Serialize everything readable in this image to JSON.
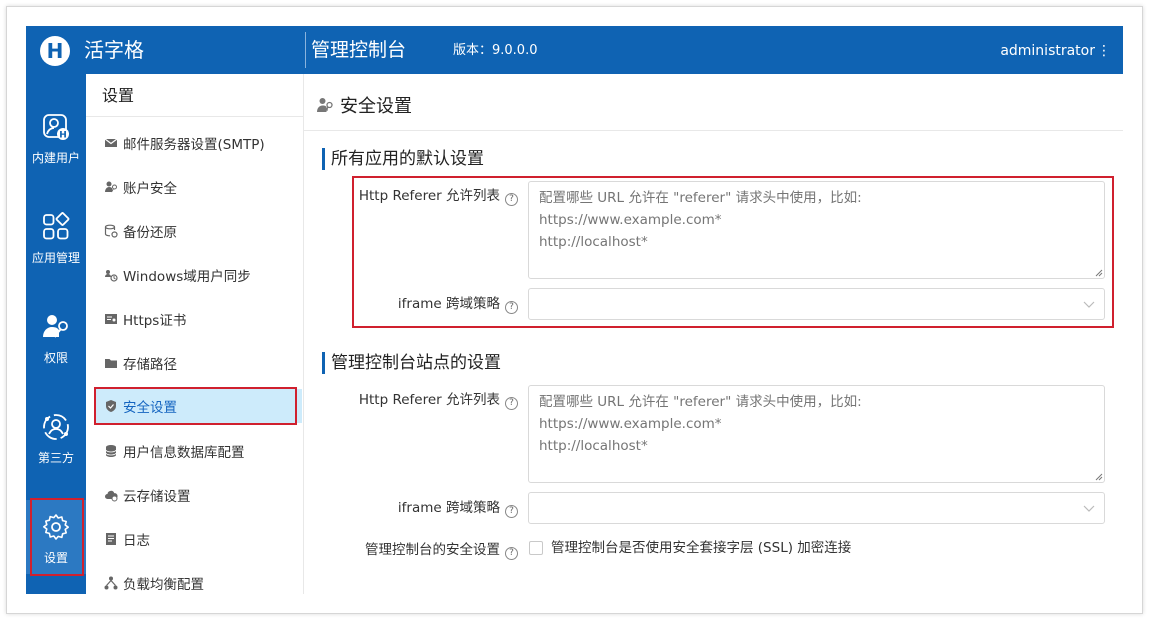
{
  "header": {
    "logo_letter": "H",
    "brand": "活字格",
    "console_title": "管理控制台",
    "version": "版本：9.0.0.0",
    "user": "administrator",
    "menu_glyph": "⋮"
  },
  "nav": {
    "items": [
      {
        "label": "内建用户",
        "icon": "user-badge-icon"
      },
      {
        "label": "应用管理",
        "icon": "apps-grid-icon"
      },
      {
        "label": "权限",
        "icon": "user-key-icon"
      },
      {
        "label": "第三方",
        "icon": "third-party-icon"
      },
      {
        "label": "设置",
        "icon": "gear-icon",
        "active": true
      }
    ]
  },
  "sidebar": {
    "title": "设置",
    "items": [
      {
        "label": "邮件服务器设置(SMTP)",
        "icon": "mail-icon"
      },
      {
        "label": "账户安全",
        "icon": "user-key-icon"
      },
      {
        "label": "备份还原",
        "icon": "backup-icon"
      },
      {
        "label": "Windows域用户同步",
        "icon": "sync-users-icon"
      },
      {
        "label": "Https证书",
        "icon": "certificate-icon"
      },
      {
        "label": "存储路径",
        "icon": "folder-icon"
      },
      {
        "label": "安全设置",
        "icon": "shield-icon",
        "active": true
      },
      {
        "label": "用户信息数据库配置",
        "icon": "database-icon"
      },
      {
        "label": "云存储设置",
        "icon": "cloud-icon"
      },
      {
        "label": "日志",
        "icon": "log-icon"
      },
      {
        "label": "负载均衡配置",
        "icon": "load-balance-icon"
      }
    ]
  },
  "main": {
    "page_title": "安全设置",
    "help_glyph": "?",
    "sections": [
      {
        "title": "所有应用的默认设置",
        "referer_label": "Http Referer 允许列表",
        "referer_placeholder": "配置哪些 URL 允许在 \"referer\" 请求头中使用，比如:\nhttps://www.example.com*\nhttp://localhost*",
        "iframe_label": "iframe 跨域策略",
        "iframe_value": ""
      },
      {
        "title": "管理控制台站点的设置",
        "referer_label": "Http Referer 允许列表",
        "referer_placeholder": "配置哪些 URL 允许在 \"referer\" 请求头中使用，比如:\nhttps://www.example.com*\nhttp://localhost*",
        "iframe_label": "iframe 跨域策略",
        "iframe_value": "",
        "ssl_label": "管理控制台的安全设置",
        "ssl_checkbox_label": "管理控制台是否使用安全套接字层 (SSL) 加密连接",
        "ssl_checked": false
      }
    ]
  },
  "colors": {
    "primary": "#0f63b3",
    "nav_active": "#2c79c2",
    "sidebar_active_bg": "#cdebfb",
    "highlight_border": "#d0202e"
  }
}
